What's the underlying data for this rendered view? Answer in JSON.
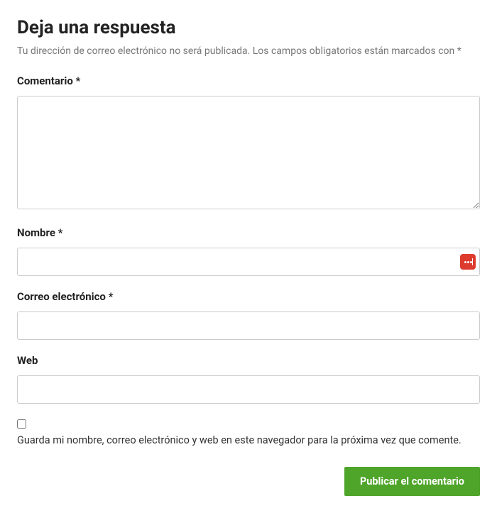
{
  "form": {
    "title": "Deja una respuesta",
    "subtitle": "Tu dirección de correo electrónico no será publicada. Los campos obligatorios están marcados con *",
    "comment_label": "Comentario *",
    "comment_value": "",
    "name_label": "Nombre *",
    "name_value": "",
    "email_label": "Correo electrónico *",
    "email_value": "",
    "web_label": "Web",
    "web_value": "",
    "save_label": "Guarda mi nombre, correo electrónico y web en este navegador para la próxima vez que comente.",
    "submit_label": "Publicar el comentario"
  }
}
